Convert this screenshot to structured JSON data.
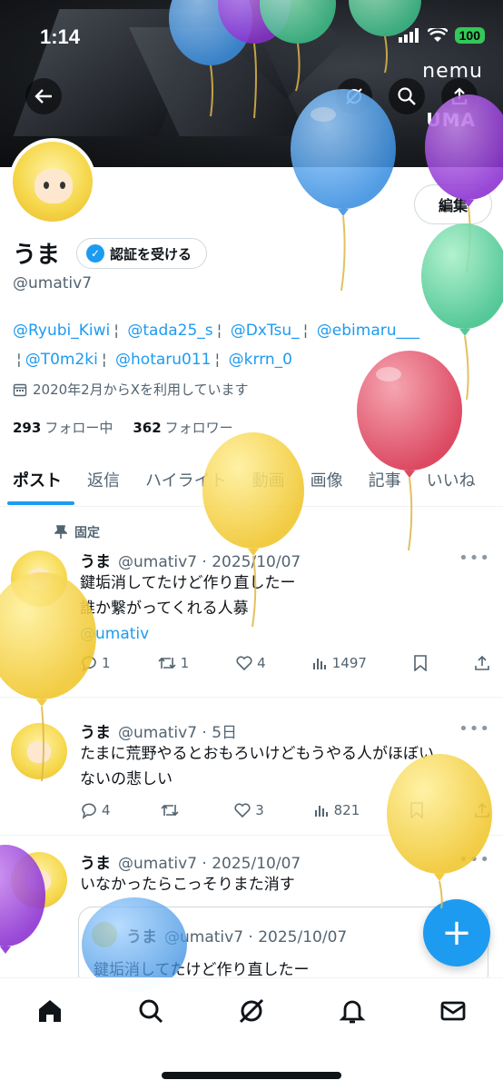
{
  "status_bar": {
    "time": "1:14",
    "battery": "100"
  },
  "banner": {
    "logo_line1": "nemu",
    "logo_line2": "UMA"
  },
  "profile": {
    "name": "うま",
    "verify_label": "認証を受ける",
    "edit_label": "編集",
    "handle": "@umativ7",
    "bio_mentions": [
      "@Ryubi_Kiwi",
      "@tada25_s",
      "@DxTsu_",
      "@ebimaru___",
      "@T0m2ki",
      "@hotaru011",
      "@krrn_0"
    ],
    "joined": "2020年2月からXを利用しています",
    "following_count": "293",
    "following_label": "フォロー中",
    "followers_count": "362",
    "followers_label": "フォロワー"
  },
  "tabs": [
    "ポスト",
    "返信",
    "ハイライト",
    "動画",
    "画像",
    "記事",
    "いいね"
  ],
  "posts": [
    {
      "pinned_label": "固定",
      "name": "うま",
      "handle_date": "@umativ7 · 2025/10/07",
      "lines": [
        "鍵垢消してたけど作り直したー",
        "誰か繋がってくれる人募"
      ],
      "link": "@umativ",
      "replies": "1",
      "reposts": "1",
      "likes": "4",
      "views": "1497"
    },
    {
      "name": "うま",
      "handle_date": "@umativ7 · 5日",
      "lines": [
        "たまに荒野やるとおもろいけどもうやる人がほぼい",
        "ないの悲しい"
      ],
      "replies": "4",
      "reposts": "",
      "likes": "3",
      "views": "821"
    },
    {
      "name": "うま",
      "handle_date": "@umativ7 · 2025/10/07",
      "lines": [
        "いなかったらこっそりまた消す"
      ],
      "quote": {
        "name": "うま",
        "handle_date": "@umativ7 · 2025/10/07",
        "text": "鍵垢消してたけど作り直したー"
      }
    }
  ],
  "fab": "+",
  "colors": {
    "accent": "#1d9bf0",
    "text": "#0f1419",
    "muted": "#536471"
  }
}
